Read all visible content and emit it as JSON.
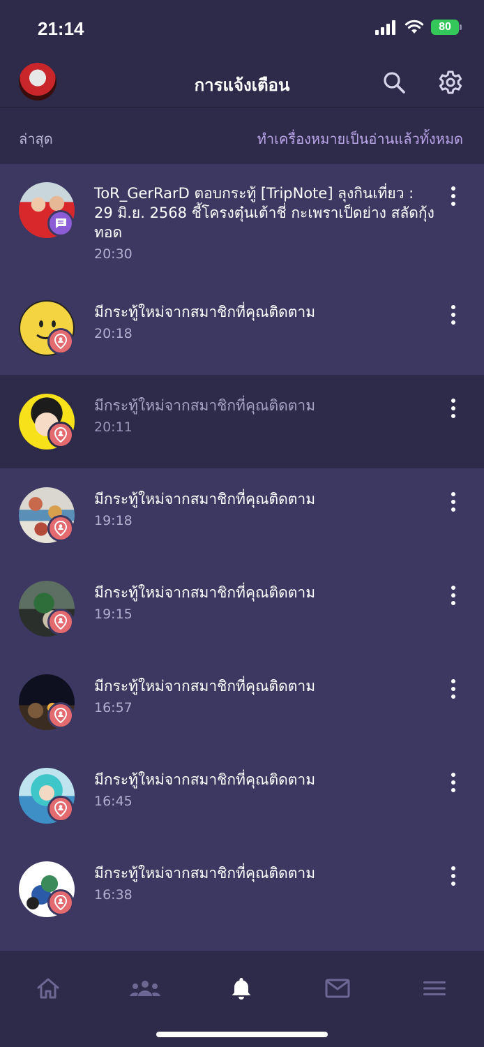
{
  "status": {
    "time": "21:14",
    "battery": "80"
  },
  "header": {
    "title": "การแจ้งเตือน"
  },
  "subbar": {
    "left": "ล่าสุด",
    "right": "ทำเครื่องหมายเป็นอ่านแล้วทั้งหมด"
  },
  "notifications": [
    {
      "text": "ToR_GerRarD ตอบกระทู้ [TripNote] ลุงกินเที่ยว : 29 มิ.ย. 2568  ชี้โครงตุ๋นเต้าชี่ กะเพราเป็ดย่าง สลัดกุ้งทอด",
      "time": "20:30",
      "badge": "comment-icon",
      "read": false
    },
    {
      "text": "มีกระทู้ใหม่จากสมาชิกที่คุณติดตาม",
      "time": "20:18",
      "badge": "pin-person-icon",
      "read": false
    },
    {
      "text": "มีกระทู้ใหม่จากสมาชิกที่คุณติดตาม",
      "time": "20:11",
      "badge": "pin-person-icon",
      "read": true
    },
    {
      "text": "มีกระทู้ใหม่จากสมาชิกที่คุณติดตาม",
      "time": "19:18",
      "badge": "pin-person-icon",
      "read": false
    },
    {
      "text": "มีกระทู้ใหม่จากสมาชิกที่คุณติดตาม",
      "time": "19:15",
      "badge": "pin-person-icon",
      "read": false
    },
    {
      "text": "มีกระทู้ใหม่จากสมาชิกที่คุณติดตาม",
      "time": "16:57",
      "badge": "pin-person-icon",
      "read": false
    },
    {
      "text": "มีกระทู้ใหม่จากสมาชิกที่คุณติดตาม",
      "time": "16:45",
      "badge": "pin-person-icon",
      "read": false
    },
    {
      "text": "มีกระทู้ใหม่จากสมาชิกที่คุณติดตาม",
      "time": "16:38",
      "badge": "pin-person-icon",
      "read": false
    }
  ],
  "tabbar": {
    "items": [
      "home-icon",
      "community-icon",
      "bell-icon",
      "mail-icon",
      "menu-icon"
    ],
    "active": "bell-icon"
  },
  "colors": {
    "background": "#2e2a4a",
    "unread_row": "#3d3862",
    "accent": "#b9a4e8",
    "pin_badge": "#e36a6e",
    "comment_badge": "#8b5cd6"
  }
}
